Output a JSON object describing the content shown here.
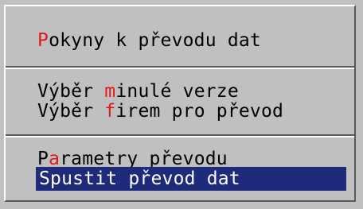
{
  "menu": {
    "groups": [
      {
        "items": [
          {
            "hotkey": "P",
            "rest": "okyny k převodu dat",
            "pre": ""
          }
        ]
      },
      {
        "items": [
          {
            "pre": "Výběr ",
            "hotkey": "m",
            "rest": "inulé verze"
          },
          {
            "pre": "Výběr ",
            "hotkey": "f",
            "rest": "irem pro převod"
          }
        ]
      },
      {
        "items": [
          {
            "pre": "P",
            "hotkey": "a",
            "rest": "rametry převodu"
          },
          {
            "pre": "Spustit převod dat",
            "hotkey": "",
            "rest": "",
            "selected": true
          }
        ]
      }
    ]
  },
  "colors": {
    "background": "#c0c0c0",
    "hotkey": "#e01818",
    "selection": "#1e2a7a",
    "text": "#000000"
  }
}
